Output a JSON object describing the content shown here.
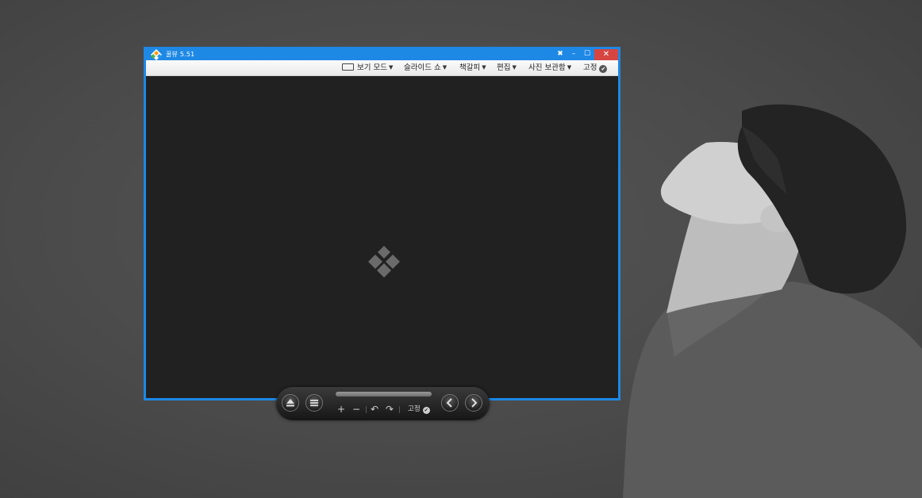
{
  "window": {
    "title": "꿀뷰 5.51",
    "pin_glyph": "✖",
    "minimize_glyph": "–",
    "maximize_glyph": "☐",
    "close_glyph": "✕"
  },
  "menu": {
    "view_mode": "보기 모드",
    "slideshow": "슬라이드 쇼",
    "bookmark": "책갈피",
    "edit": "편집",
    "photo_storage": "사진 보관함",
    "pin": "고정",
    "caret": "▼",
    "check": "✔"
  },
  "controls": {
    "zoom_in": "+",
    "zoom_out": "−",
    "rotate_left": "↶",
    "rotate_right": "↷",
    "pin": "고정",
    "check": "✔"
  },
  "colors": {
    "window_border": "#1e88e5",
    "close_button": "#d64541",
    "viewer_background": "#212121"
  }
}
